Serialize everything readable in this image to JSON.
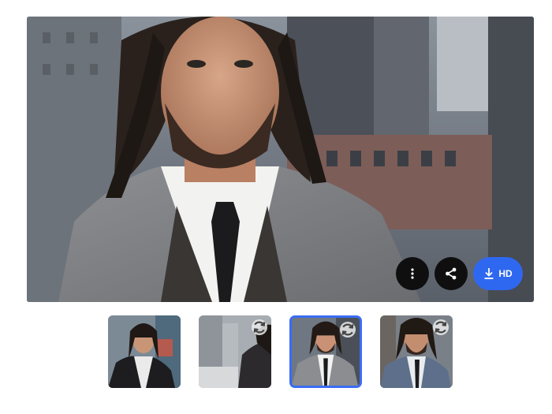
{
  "main_image": {
    "icon": "portrait-photo-icon"
  },
  "actions": {
    "more": {
      "icon": "vertical-dots-icon"
    },
    "share": {
      "icon": "share-icon"
    },
    "download": {
      "icon": "download-icon",
      "label": "HD"
    }
  },
  "thumbnails": [
    {
      "selected": false,
      "badge": null
    },
    {
      "selected": false,
      "badge": "regenerate-icon"
    },
    {
      "selected": true,
      "badge": "regenerate-icon"
    },
    {
      "selected": false,
      "badge": "regenerate-icon"
    }
  ],
  "colors": {
    "accent": "#2f68f0",
    "selected_border": "#3a6cf4",
    "dark_button": "#0f0f10"
  }
}
